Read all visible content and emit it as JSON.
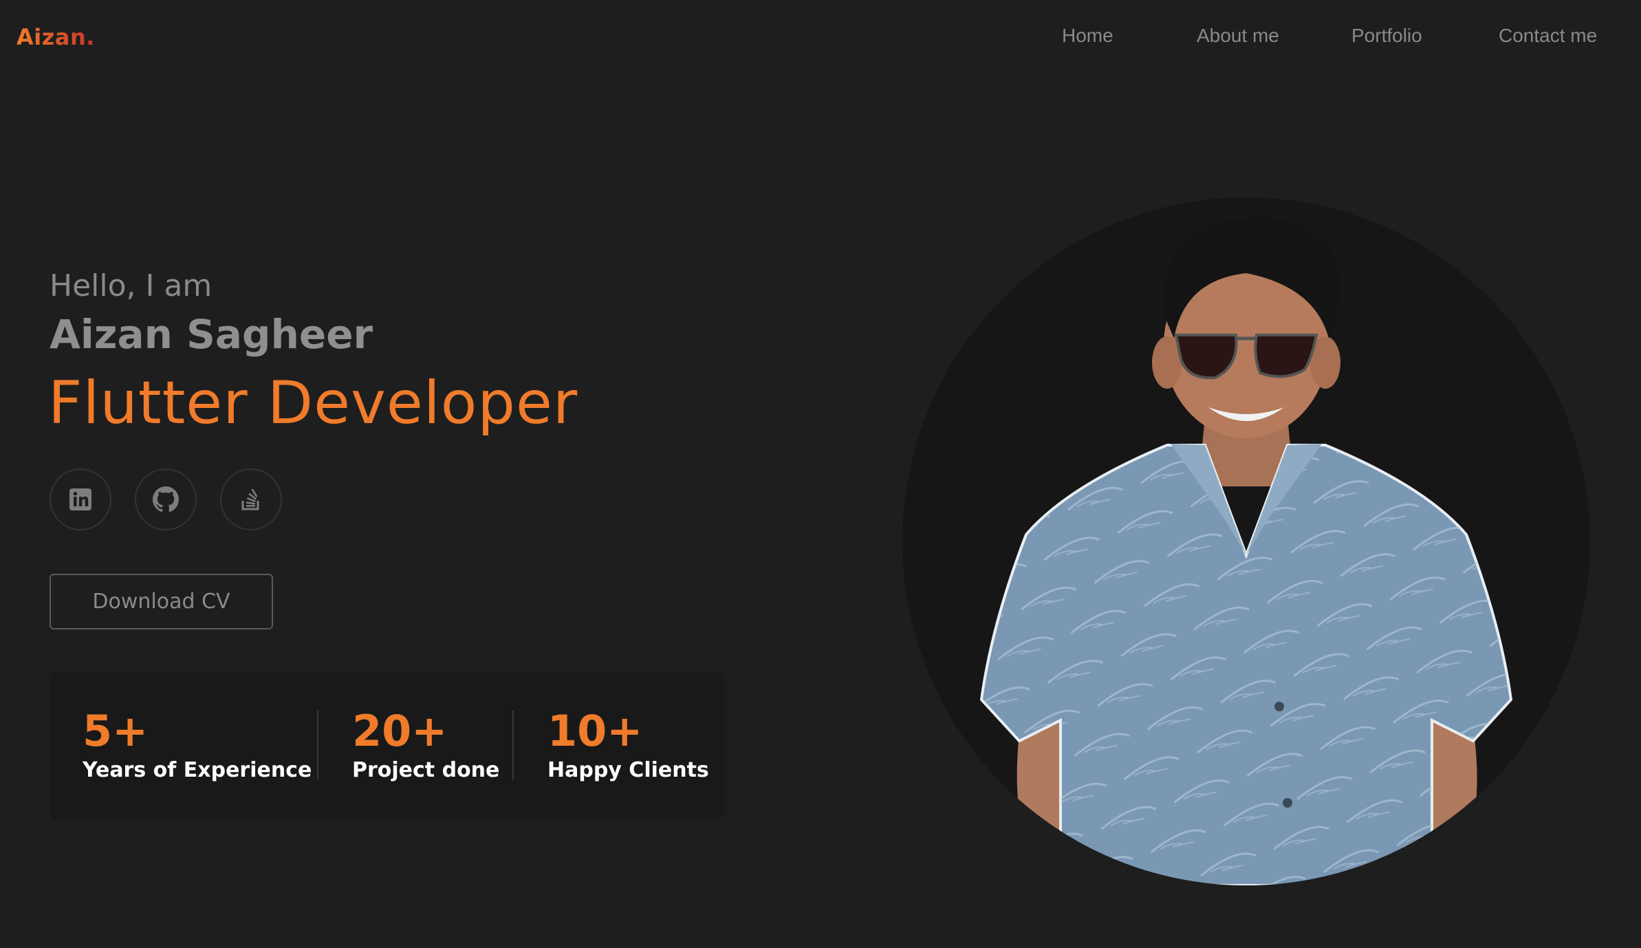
{
  "header": {
    "logo": "Aizan.",
    "nav": [
      "Home",
      "About me",
      "Portfolio",
      "Contact me"
    ]
  },
  "hero": {
    "greeting": "Hello, I am",
    "name": "Aizan Sagheer",
    "role": "Flutter Developer",
    "social_icons": [
      "linkedin-icon",
      "github-icon",
      "stack-overflow-icon"
    ],
    "cta": "Download CV"
  },
  "stats": [
    {
      "value": "5+",
      "label": "Years of Experience"
    },
    {
      "value": "20+",
      "label": "Project done"
    },
    {
      "value": "10+",
      "label": "Happy Clients"
    }
  ],
  "colors": {
    "background": "#1e1e1e",
    "accent": "#ef7b2b",
    "logo_gradient_end": "#c9352a",
    "muted_text": "#8a8a8a",
    "stats_panel": "#191919",
    "portrait_circle": "#161616",
    "shirt": "#7a98b4"
  }
}
